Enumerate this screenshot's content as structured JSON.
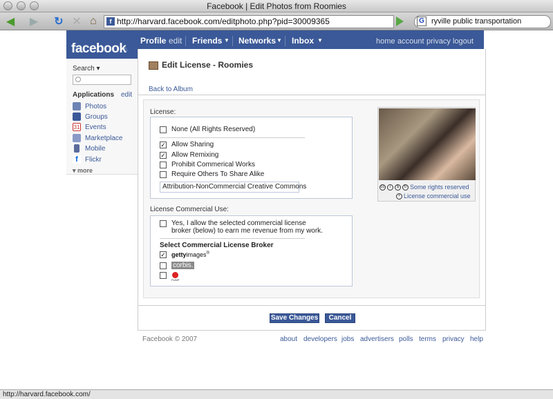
{
  "window": {
    "title": "Facebook | Edit Photos from Roomies"
  },
  "browser": {
    "url": "http://harvard.facebook.com/editphoto.php?pid=30009365",
    "search_value": "ryville public transportation"
  },
  "header": {
    "logo": "facebook",
    "nav": {
      "profile": "Profile",
      "edit": "edit",
      "friends": "Friends",
      "networks": "Networks",
      "inbox": "Inbox"
    },
    "right": {
      "home": "home",
      "account": "account",
      "privacy": "privacy",
      "logout": "logout"
    }
  },
  "sidebar": {
    "search_label": "Search ▾",
    "apps_label": "Applications",
    "apps_edit": "edit",
    "apps": [
      "Photos",
      "Groups",
      "Events",
      "Marketplace",
      "Mobile",
      "Flickr"
    ],
    "more": "▾ more"
  },
  "main": {
    "title": "Edit License - Roomies",
    "back": "Back to Album",
    "license_label": "License:",
    "options": {
      "none": "None (All Rights Reserved)",
      "sharing": "Allow Sharing",
      "remixing": "Allow Remixing",
      "prohibit": "Prohibit Commerical Works",
      "share_alike": "Require Others To Share Alike"
    },
    "license_value": "Attribution-NonCommercial Creative Commons",
    "commercial_label": "License Commercial Use:",
    "commercial_optin_line1": "Yes, I allow the selected commercial license",
    "commercial_optin_line2": "broker (below) to earn me revenue from my work.",
    "broker_heading": "Select Commercial License Broker",
    "brokers": {
      "getty_bold": "getty",
      "getty_rest": "images",
      "getty_mark": "®",
      "corbis": "corbis.",
      "pump_label": "PUMP"
    },
    "cc_rights": "Some rights reserved",
    "cc_commercial": "License commercial use",
    "save": "Save Changes",
    "cancel": "Cancel"
  },
  "footer": {
    "copyright": "Facebook © 2007",
    "links": [
      "about",
      "developers",
      "jobs",
      "advertisers",
      "polls",
      "terms",
      "privacy",
      "help"
    ]
  },
  "status": "http://harvard.facebook.com/"
}
